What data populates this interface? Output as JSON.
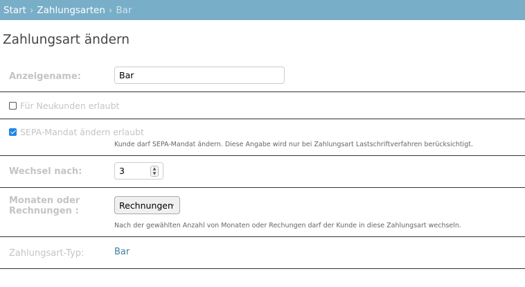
{
  "breadcrumbs": {
    "start": "Start",
    "section": "Zahlungsarten",
    "current": "Bar",
    "separator": "›"
  },
  "page_title": "Zahlungsart ändern",
  "form": {
    "display_name": {
      "label": "Anzeigename:",
      "value": "Bar"
    },
    "new_customers": {
      "label": "Für Neukunden erlaubt",
      "checked": false
    },
    "sepa_change": {
      "label": "SEPA-Mandat ändern erlaubt",
      "checked": true,
      "help": "Kunde darf SEPA-Mandat ändern. Diese Angabe wird nur bei Zahlungsart Lastschriftverfahren berücksichtigt."
    },
    "switch_after": {
      "label": "Wechsel nach:",
      "value": "3"
    },
    "months_or_invoices": {
      "label_line1": "Monaten oder",
      "label_line2": "Rechnungen :",
      "selected": "Rechnungen",
      "help": "Nach der gewählten Anzahl von Monaten oder Rechungen darf der Kunde in diese Zahlungsart wechseln."
    },
    "payment_type": {
      "label": "Zahlungsart-Typ:",
      "value": "Bar"
    }
  },
  "icons": {
    "dropdown": "chevron-down-icon",
    "spinner": "spinner-arrows-icon",
    "check": "checkmark-icon"
  },
  "colors": {
    "header_bg": "#79aec8",
    "link": "#447e9b",
    "checkbox_on": "#1e88e5"
  }
}
